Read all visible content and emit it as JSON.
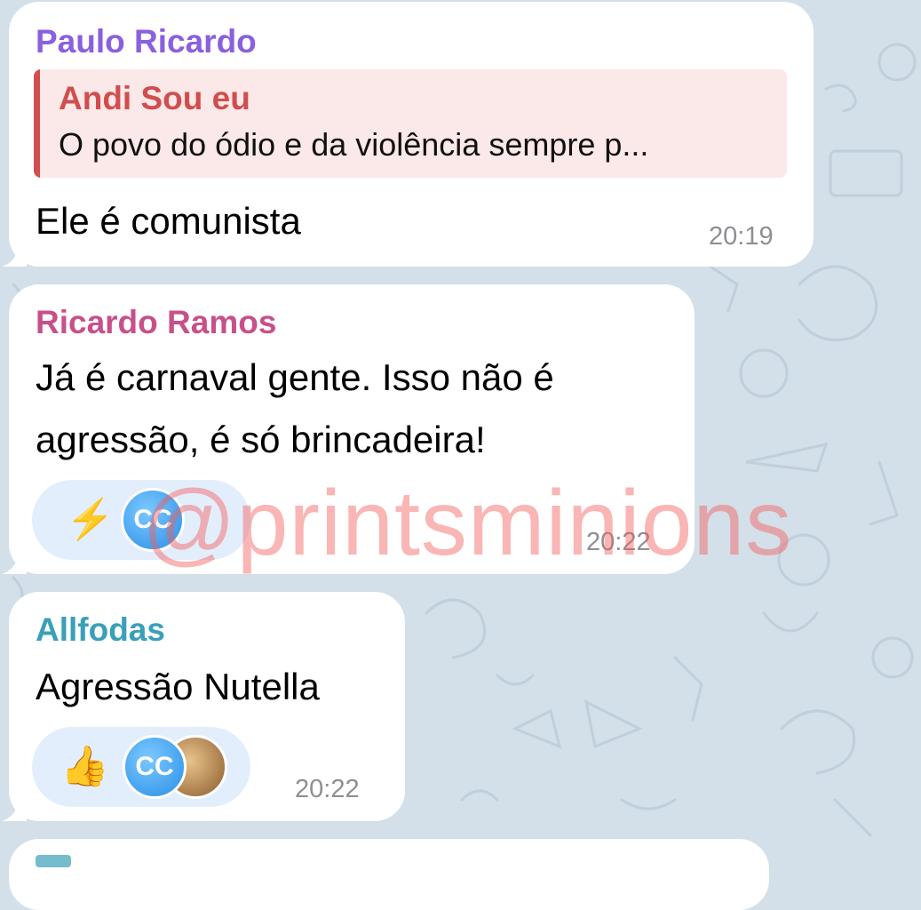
{
  "messages": [
    {
      "sender": "Paulo Ricardo",
      "sender_color": "#8a5fe0",
      "reply": {
        "name": "Andi Sou eu",
        "text": "O povo do ódio e da violência sempre p..."
      },
      "text": "Ele é comunista",
      "time": "20:19"
    },
    {
      "sender": "Ricardo Ramos",
      "sender_color": "#c8508a",
      "lines": [
        "Já é carnaval gente. Isso não é",
        "agressão, é só brincadeira!"
      ],
      "reaction": {
        "emoji": "⚡",
        "avatar_text": "CC"
      },
      "time": "20:22"
    },
    {
      "sender": "Allfodas",
      "sender_color": "#3aa0b8",
      "text": "Agressão Nutella",
      "reaction": {
        "emoji": "👍",
        "avatar_text": "CC"
      },
      "time": "20:22"
    }
  ],
  "watermark": "@printsminions",
  "colors": {
    "background": "#d3dfe9",
    "bubble": "#ffffff",
    "reaction": "#e3eefc",
    "reply_accent": "#d14e4e"
  }
}
